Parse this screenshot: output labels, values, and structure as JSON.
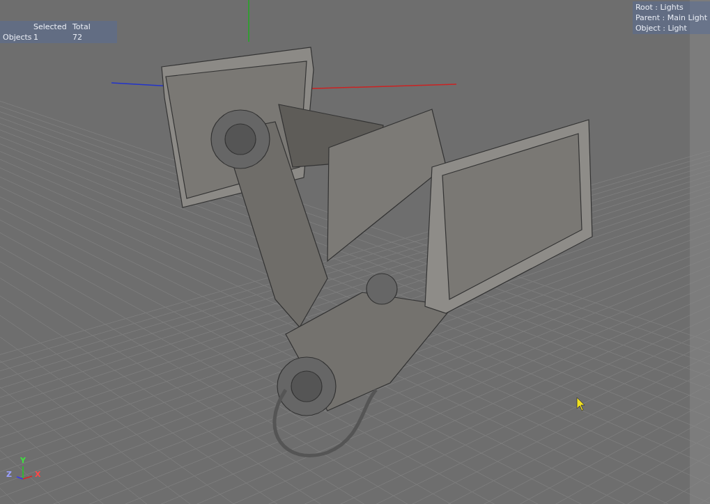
{
  "stats": {
    "columns": [
      "Selected",
      "Total"
    ],
    "rows": [
      {
        "label": "Objects",
        "selected": "1",
        "total": "72"
      }
    ]
  },
  "hierarchy": [
    "Root : Lights",
    "Parent : Main Light",
    "Object : Light"
  ],
  "axes": {
    "x": "X",
    "y": "Y",
    "z": "Z"
  }
}
